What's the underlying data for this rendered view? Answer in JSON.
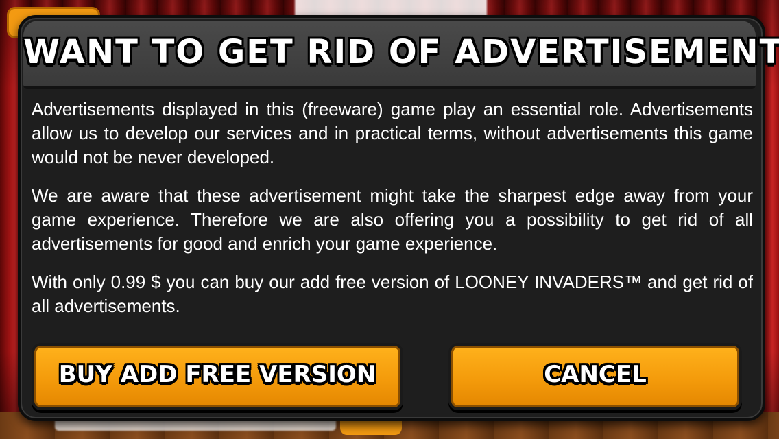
{
  "dialog": {
    "title": "WANT TO GET RID OF ADVERTISEMENTS?",
    "paragraphs": [
      "Advertisements displayed in this (freeware) game play an essential role. Advertisements allow us to develop our services and in practical terms, without advertisements this game would not be never developed.",
      "We are aware that these advertisement might take the sharpest edge away from your game experience. Therefore we are also offering you a possibility to get rid of all advertisements for good and enrich your game experience.",
      "With only 0.99 $ you can buy our add free version of LOONEY INVADERS™ and get rid of all advertisements."
    ],
    "buy_label": "BUY ADD FREE VERSION",
    "cancel_label": "CANCEL"
  },
  "colors": {
    "curtain": "#a21414",
    "dialog_bg": "#1e1e1e",
    "header_bg": "#3a3a3a",
    "button": "#f49b0b",
    "text": "#ffffff"
  }
}
